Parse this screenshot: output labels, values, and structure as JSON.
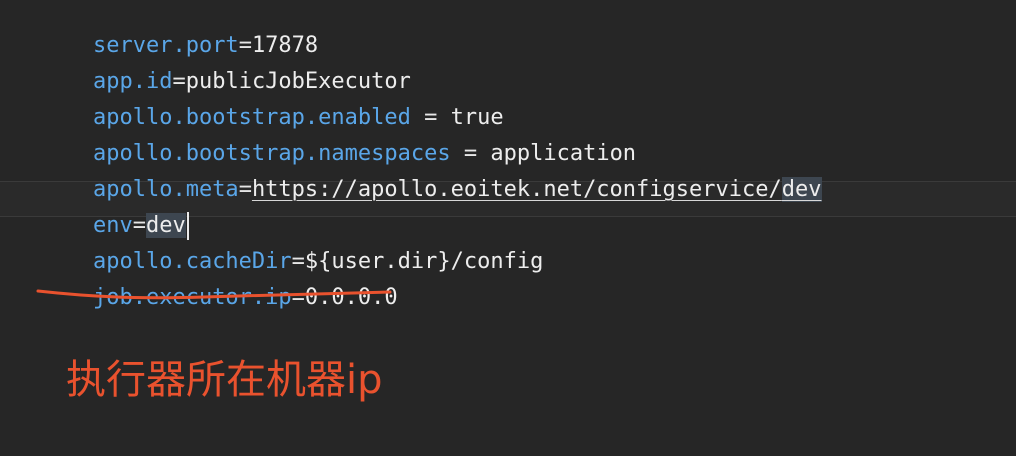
{
  "editor": {
    "lines": [
      {
        "key": "server.port",
        "eq": "=",
        "value": "17878"
      },
      {
        "key": "app.id",
        "eq": "=",
        "value": "publicJobExecutor"
      },
      {
        "key": "apollo.bootstrap.enabled",
        "eq": " = ",
        "value": "true"
      },
      {
        "key": "apollo.bootstrap.namespaces",
        "eq": " = ",
        "value": "application"
      },
      {
        "key": "apollo.meta",
        "eq": "=",
        "value_prefix": "https://apollo.eoitek.net/configservice/",
        "value_highlight": "dev"
      },
      {
        "key": "env",
        "eq": "=",
        "value_highlight": "dev"
      },
      {
        "key": "apollo.cacheDir",
        "eq": "=",
        "value": "${user.dir}/config"
      },
      {
        "key": "job.executor.ip",
        "eq": "=",
        "value": "0.0.0.0"
      }
    ]
  },
  "annotation": {
    "text": "执行器所在机器ip",
    "color": "#e9522e"
  },
  "colors": {
    "background": "#262626",
    "key": "#5aa6e8",
    "text": "#e6e6e6",
    "highlight": "#3d4650",
    "annotation_red": "#e9522e"
  }
}
